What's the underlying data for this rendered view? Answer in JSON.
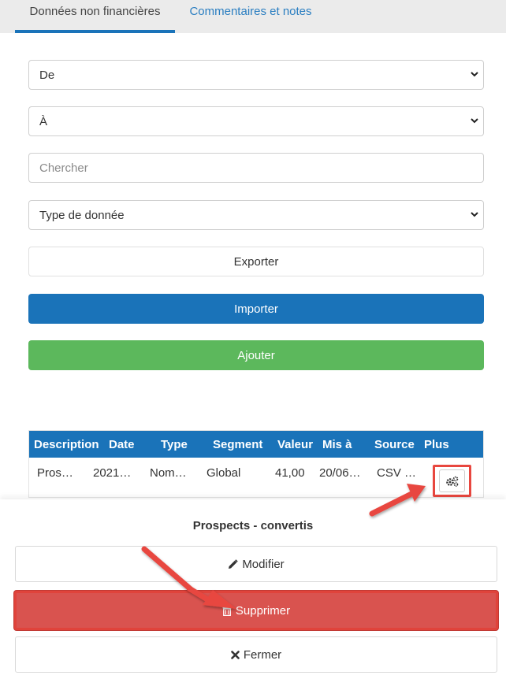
{
  "tabs": {
    "active": "Données non financières",
    "inactive": "Commentaires et notes"
  },
  "filters": {
    "from": "De",
    "to": "À",
    "search_placeholder": "Chercher",
    "data_type": "Type de donnée"
  },
  "buttons": {
    "export": "Exporter",
    "import": "Importer",
    "add": "Ajouter"
  },
  "table": {
    "headers": [
      "Description",
      "Date",
      "Type",
      "Segment",
      "Valeur",
      "Mis à",
      "Source",
      "Plus"
    ],
    "rows": [
      [
        "Pros…",
        "2021…",
        "Nom…",
        "Global",
        "41,00",
        "20/06…",
        "CSV …"
      ]
    ]
  },
  "sheet": {
    "title": "Prospects - convertis",
    "modify": "Modifier",
    "delete": "Supprimer",
    "close": "Fermer"
  },
  "colors": {
    "primary": "#1a73b9",
    "success": "#5cb85c",
    "danger": "#d9534f",
    "highlight": "#e8473f"
  }
}
